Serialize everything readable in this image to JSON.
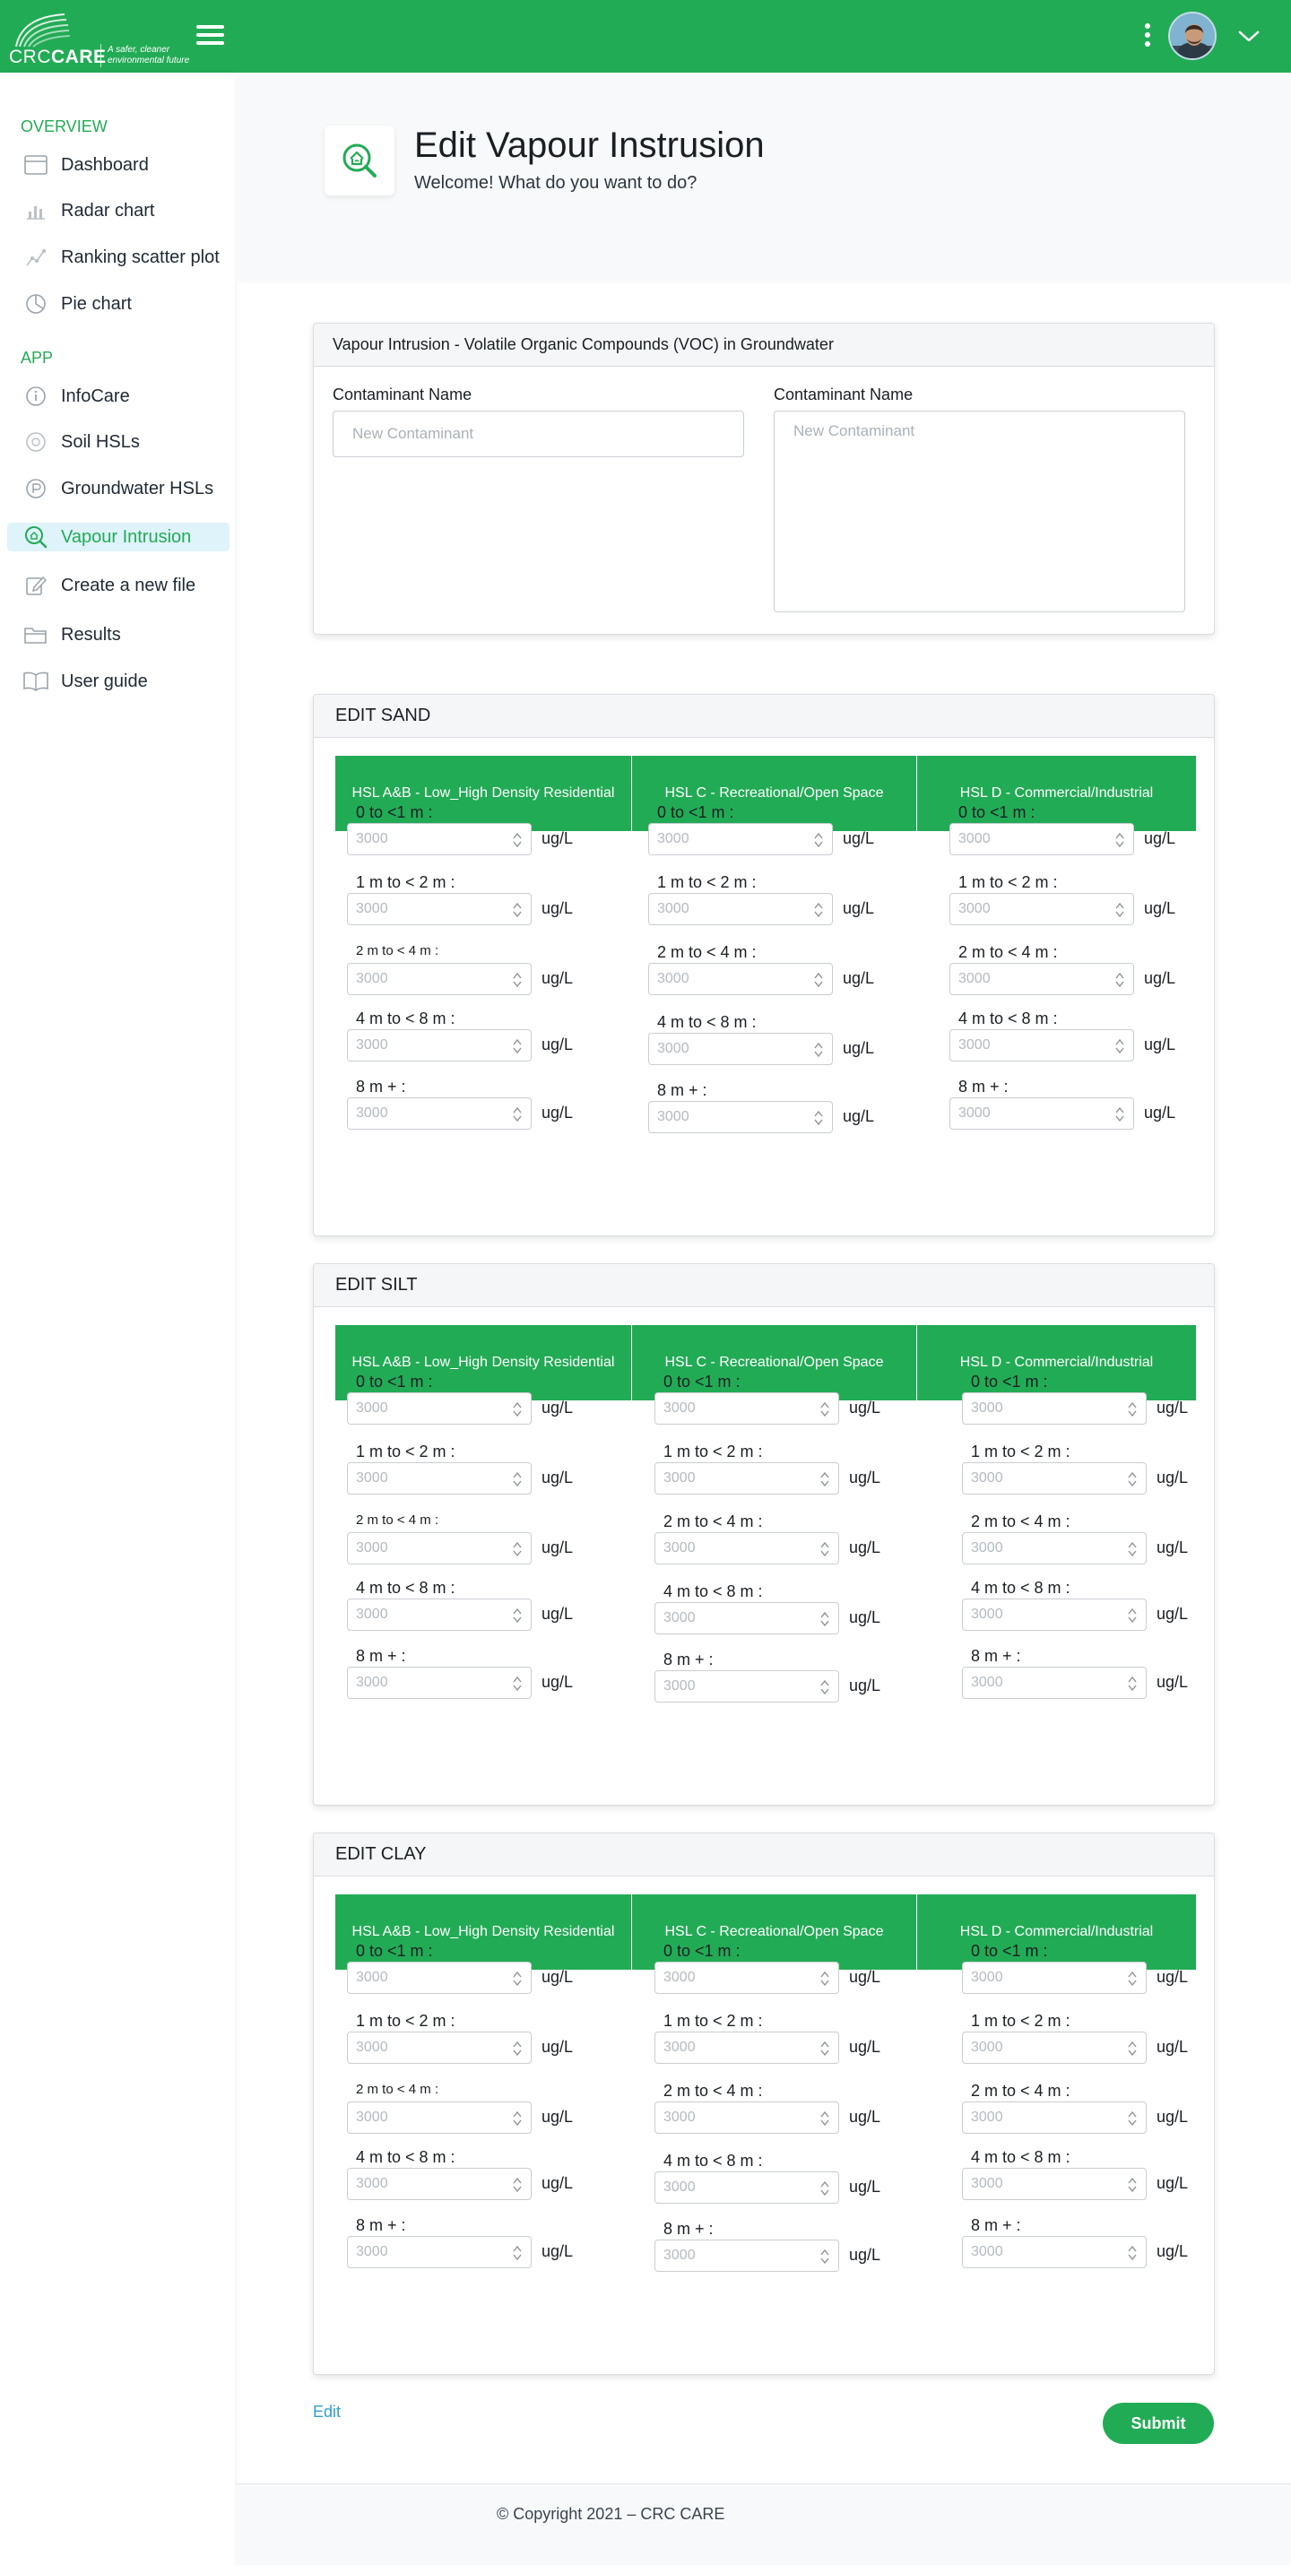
{
  "brand": {
    "name_light": "CRC",
    "name_bold": "CARE",
    "tagline_line1": "A safer, cleaner",
    "tagline_line2": "environmental future"
  },
  "colors": {
    "accent": "#22ab55",
    "active_bg": "#dff3fb",
    "link": "#2e9fd0"
  },
  "sidebar": {
    "section_overview": "OVERVIEW",
    "section_app": "APP",
    "items": [
      {
        "label": "Dashboard",
        "icon": "dashboard-icon"
      },
      {
        "label": "Radar chart",
        "icon": "bar-chart-icon"
      },
      {
        "label": "Ranking scatter plot",
        "icon": "scatter-icon"
      },
      {
        "label": "Pie chart",
        "icon": "pie-chart-icon"
      },
      {
        "label": "InfoCare",
        "icon": "info-icon"
      },
      {
        "label": "Soil HSLs",
        "icon": "soil-icon"
      },
      {
        "label": "Groundwater HSLs",
        "icon": "groundwater-icon"
      },
      {
        "label": "Vapour Intrusion",
        "icon": "vapour-icon",
        "active": true
      },
      {
        "label": "Create a new file",
        "icon": "edit-file-icon"
      },
      {
        "label": "Results",
        "icon": "folder-icon"
      },
      {
        "label": "User guide",
        "icon": "book-icon"
      }
    ]
  },
  "page": {
    "title": "Edit Vapour Instrusion",
    "subtitle": "Welcome! What do you want to do?"
  },
  "voc_card": {
    "title": "Vapour Intrusion - Volatile Organic Compounds (VOC) in Groundwater",
    "field1_label": "Contaminant Name",
    "field1_placeholder": "New Contaminant",
    "field2_label": "Contaminant Name",
    "field2_placeholder": "New Contaminant"
  },
  "columns": [
    "HSL A&B - Low_High Density Residential",
    "HSL C - Recreational/Open Space",
    "HSL D - Commercial/Industrial"
  ],
  "depths": [
    "0 to <1 m :",
    "1 m to < 2 m :",
    "2 m to < 4 m :",
    "4 m to < 8 m :",
    "8 m + :"
  ],
  "placeholder_value": "3000",
  "unit": "ug/L",
  "sections": [
    {
      "title": "EDIT SAND"
    },
    {
      "title": "EDIT SILT"
    },
    {
      "title": "EDIT CLAY"
    }
  ],
  "actions": {
    "edit_label": "Edit",
    "submit_label": "Submit"
  },
  "footer": {
    "copyright": "© Copyright 2021 – CRC CARE"
  }
}
